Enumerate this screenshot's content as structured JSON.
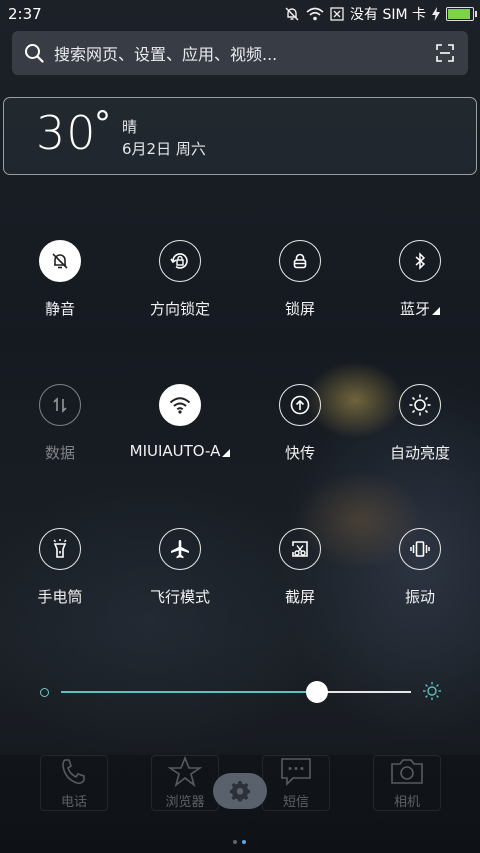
{
  "status_bar": {
    "time": "2:37",
    "carrier": "没有 SIM 卡"
  },
  "search": {
    "placeholder": "搜索网页、设置、应用、视频..."
  },
  "weather": {
    "temperature": "30",
    "degree": "°",
    "condition": "晴",
    "date": "6月2日 周六"
  },
  "toggles": [
    {
      "label": "静音",
      "state": "on",
      "icon": "bell-off-icon"
    },
    {
      "label": "方向锁定",
      "state": "off",
      "icon": "rotation-lock-icon"
    },
    {
      "label": "锁屏",
      "state": "off",
      "icon": "lock-icon"
    },
    {
      "label": "蓝牙",
      "state": "off",
      "icon": "bluetooth-icon"
    },
    {
      "label": "数据",
      "state": "disabled",
      "icon": "mobile-data-icon"
    },
    {
      "label": "MIUIAUTO-A",
      "state": "on",
      "icon": "wifi-icon"
    },
    {
      "label": "快传",
      "state": "off",
      "icon": "quick-transfer-icon"
    },
    {
      "label": "自动亮度",
      "state": "off",
      "icon": "auto-brightness-icon"
    },
    {
      "label": "手电筒",
      "state": "off",
      "icon": "flashlight-icon"
    },
    {
      "label": "飞行模式",
      "state": "off",
      "icon": "airplane-icon"
    },
    {
      "label": "截屏",
      "state": "off",
      "icon": "screenshot-icon"
    },
    {
      "label": "振动",
      "state": "off",
      "icon": "vibrate-icon"
    }
  ],
  "brightness": {
    "level": 0.73
  },
  "dock": {
    "items": [
      {
        "label": "电话",
        "icon": "phone-icon"
      },
      {
        "label": "浏览器",
        "icon": "browser-star-icon"
      },
      {
        "label": "短信",
        "icon": "message-icon"
      },
      {
        "label": "相机",
        "icon": "camera-icon"
      }
    ],
    "settings_icon": "gear-icon"
  },
  "colors": {
    "accent": "#5cc2bd",
    "battery": "#7ed24a",
    "page_indicator": "#5aa6e6"
  }
}
